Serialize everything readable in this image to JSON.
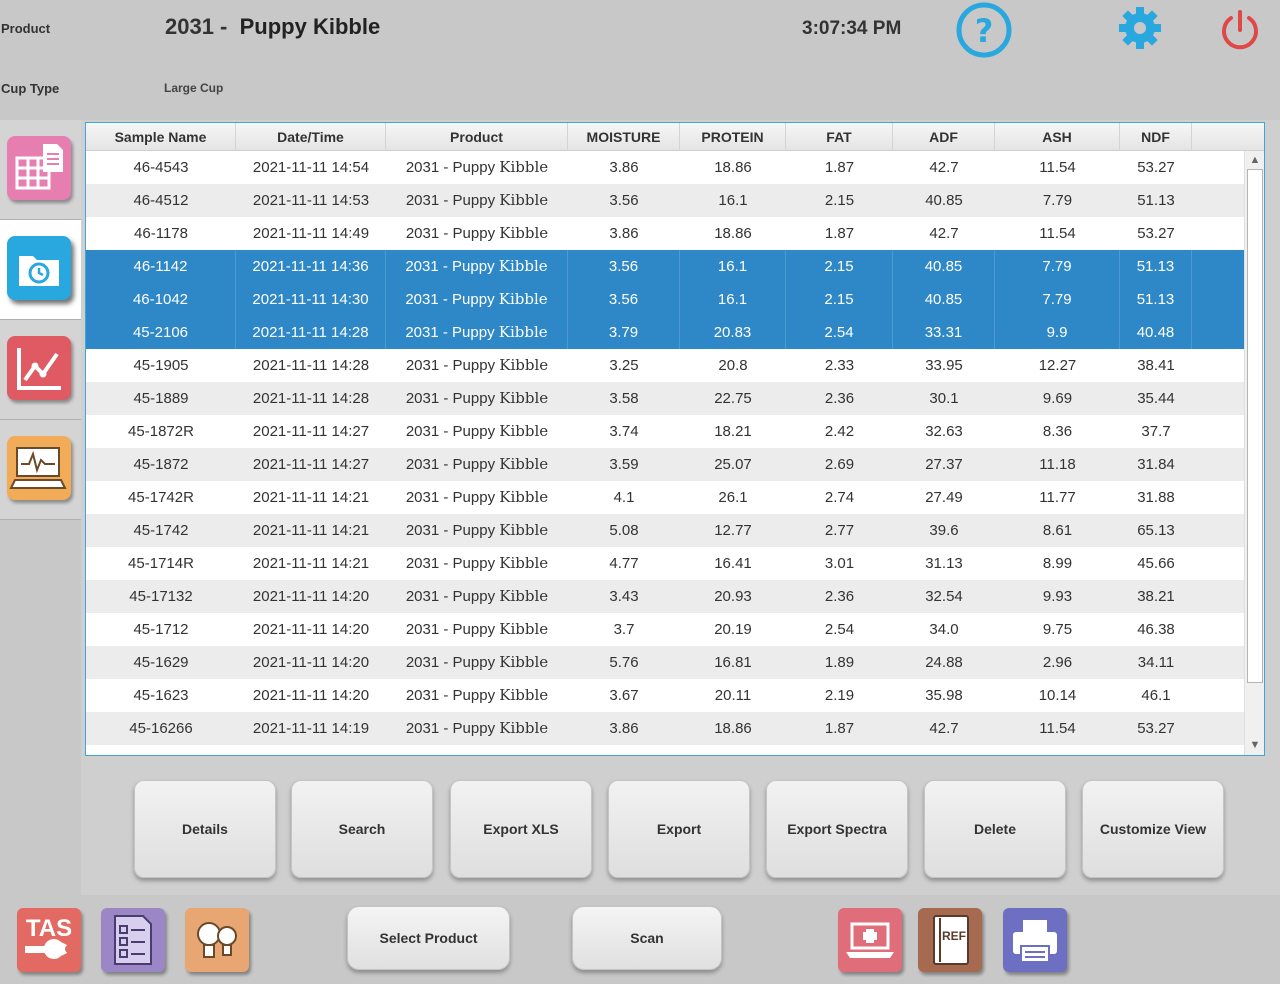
{
  "header": {
    "product_label": "Product",
    "product_number": "2031 -",
    "product_name": "Puppy Kibble",
    "time": "3:07:34 PM",
    "cup_type_label": "Cup Type",
    "cup_type_value": "Large Cup"
  },
  "icons": {
    "help": "help-icon",
    "settings": "gear-icon",
    "power": "power-icon"
  },
  "sidebar": {
    "items": [
      {
        "name": "spreadsheet-icon",
        "color": "#e67fb0"
      },
      {
        "name": "history-folder-icon",
        "color": "#29a7df"
      },
      {
        "name": "line-chart-icon",
        "color": "#e05a63"
      },
      {
        "name": "monitor-scan-icon",
        "color": "#f2ab56"
      }
    ]
  },
  "table": {
    "columns": [
      "Sample Name",
      "Date/Time",
      "Product",
      "MOISTURE",
      "PROTEIN",
      "FAT",
      "ADF",
      "ASH",
      "NDF"
    ],
    "product_prefix": "2031 - Puppy ",
    "product_suffix": "Kibble",
    "rows": [
      {
        "sample": "46-4543",
        "datetime": "2021-11-11 14:54",
        "moisture": "3.86",
        "protein": "18.86",
        "fat": "1.87",
        "adf": "42.7",
        "ash": "11.54",
        "ndf": "53.27",
        "selected": false
      },
      {
        "sample": "46-4512",
        "datetime": "2021-11-11 14:53",
        "moisture": "3.56",
        "protein": "16.1",
        "fat": "2.15",
        "adf": "40.85",
        "ash": "7.79",
        "ndf": "51.13",
        "selected": false
      },
      {
        "sample": "46-1178",
        "datetime": "2021-11-11 14:49",
        "moisture": "3.86",
        "protein": "18.86",
        "fat": "1.87",
        "adf": "42.7",
        "ash": "11.54",
        "ndf": "53.27",
        "selected": false
      },
      {
        "sample": "46-1142",
        "datetime": "2021-11-11 14:36",
        "moisture": "3.56",
        "protein": "16.1",
        "fat": "2.15",
        "adf": "40.85",
        "ash": "7.79",
        "ndf": "51.13",
        "selected": true
      },
      {
        "sample": "46-1042",
        "datetime": "2021-11-11 14:30",
        "moisture": "3.56",
        "protein": "16.1",
        "fat": "2.15",
        "adf": "40.85",
        "ash": "7.79",
        "ndf": "51.13",
        "selected": true
      },
      {
        "sample": "45-2106",
        "datetime": "2021-11-11 14:28",
        "moisture": "3.79",
        "protein": "20.83",
        "fat": "2.54",
        "adf": "33.31",
        "ash": "9.9",
        "ndf": "40.48",
        "selected": true
      },
      {
        "sample": "45-1905",
        "datetime": "2021-11-11 14:28",
        "moisture": "3.25",
        "protein": "20.8",
        "fat": "2.33",
        "adf": "33.95",
        "ash": "12.27",
        "ndf": "38.41",
        "selected": false
      },
      {
        "sample": "45-1889",
        "datetime": "2021-11-11 14:28",
        "moisture": "3.58",
        "protein": "22.75",
        "fat": "2.36",
        "adf": "30.1",
        "ash": "9.69",
        "ndf": "35.44",
        "selected": false
      },
      {
        "sample": "45-1872R",
        "datetime": "2021-11-11 14:27",
        "moisture": "3.74",
        "protein": "18.21",
        "fat": "2.42",
        "adf": "32.63",
        "ash": "8.36",
        "ndf": "37.7",
        "selected": false
      },
      {
        "sample": "45-1872",
        "datetime": "2021-11-11 14:27",
        "moisture": "3.59",
        "protein": "25.07",
        "fat": "2.69",
        "adf": "27.37",
        "ash": "11.18",
        "ndf": "31.84",
        "selected": false
      },
      {
        "sample": "45-1742R",
        "datetime": "2021-11-11 14:21",
        "moisture": "4.1",
        "protein": "26.1",
        "fat": "2.74",
        "adf": "27.49",
        "ash": "11.77",
        "ndf": "31.88",
        "selected": false
      },
      {
        "sample": "45-1742",
        "datetime": "2021-11-11 14:21",
        "moisture": "5.08",
        "protein": "12.77",
        "fat": "2.77",
        "adf": "39.6",
        "ash": "8.61",
        "ndf": "65.13",
        "selected": false
      },
      {
        "sample": "45-1714R",
        "datetime": "2021-11-11 14:21",
        "moisture": "4.77",
        "protein": "16.41",
        "fat": "3.01",
        "adf": "31.13",
        "ash": "8.99",
        "ndf": "45.66",
        "selected": false
      },
      {
        "sample": "45-17132",
        "datetime": "2021-11-11 14:20",
        "moisture": "3.43",
        "protein": "20.93",
        "fat": "2.36",
        "adf": "32.54",
        "ash": "9.93",
        "ndf": "38.21",
        "selected": false
      },
      {
        "sample": "45-1712",
        "datetime": "2021-11-11 14:20",
        "moisture": "3.7",
        "protein": "20.19",
        "fat": "2.54",
        "adf": "34.0",
        "ash": "9.75",
        "ndf": "46.38",
        "selected": false
      },
      {
        "sample": "45-1629",
        "datetime": "2021-11-11 14:20",
        "moisture": "5.76",
        "protein": "16.81",
        "fat": "1.89",
        "adf": "24.88",
        "ash": "2.96",
        "ndf": "34.11",
        "selected": false
      },
      {
        "sample": "45-1623",
        "datetime": "2021-11-11 14:20",
        "moisture": "3.67",
        "protein": "20.11",
        "fat": "2.19",
        "adf": "35.98",
        "ash": "10.14",
        "ndf": "46.1",
        "selected": false
      },
      {
        "sample": "45-16266",
        "datetime": "2021-11-11 14:19",
        "moisture": "3.86",
        "protein": "18.86",
        "fat": "1.87",
        "adf": "42.7",
        "ash": "11.54",
        "ndf": "53.27",
        "selected": false
      }
    ]
  },
  "actions": [
    "Details",
    "Search",
    "Export XLS",
    "Export",
    "Export Spectra",
    "Delete",
    "Customize View"
  ],
  "footer": {
    "tas_label": "TAS",
    "select_product": "Select Product",
    "scan": "Scan",
    "ref_label": "REF"
  },
  "colors": {
    "accent": "#2e88c7",
    "help": "#29a7df",
    "power": "#e04848",
    "tas": "#e26a62",
    "checklist": "#9b86c6",
    "bulb": "#e8a673",
    "laptop": "#e06e7a",
    "ref": "#a56a4f",
    "printer": "#6d6fc3"
  }
}
